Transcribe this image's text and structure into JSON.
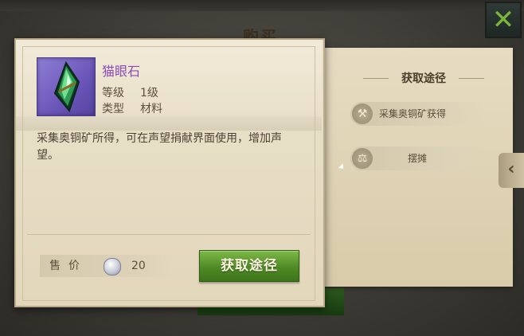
{
  "dialog": {
    "title": "购买"
  },
  "item": {
    "name": "猫眼石",
    "level_label": "等级",
    "level_value": "1级",
    "type_label": "类型",
    "type_value": "材料",
    "description": "采集奥铜矿所得，可在声望捐献界面使用，增加声望。",
    "icon": "gem-icon"
  },
  "price": {
    "label": "售价",
    "value": "20",
    "currency_icon": "silver-coin-icon"
  },
  "acquire_button": {
    "label": "获取途径"
  },
  "acquisition": {
    "title": "获取途径",
    "methods": [
      {
        "label": "采集奥铜矿获得",
        "icon": "pickaxe-icon"
      },
      {
        "label": "摆摊",
        "icon": "scale-icon"
      }
    ]
  },
  "colors": {
    "item_name": "#8a4cb8",
    "button_green": "#4e8a25",
    "icon_bg": "#6a55b8",
    "close_x": "#7bb63b"
  }
}
